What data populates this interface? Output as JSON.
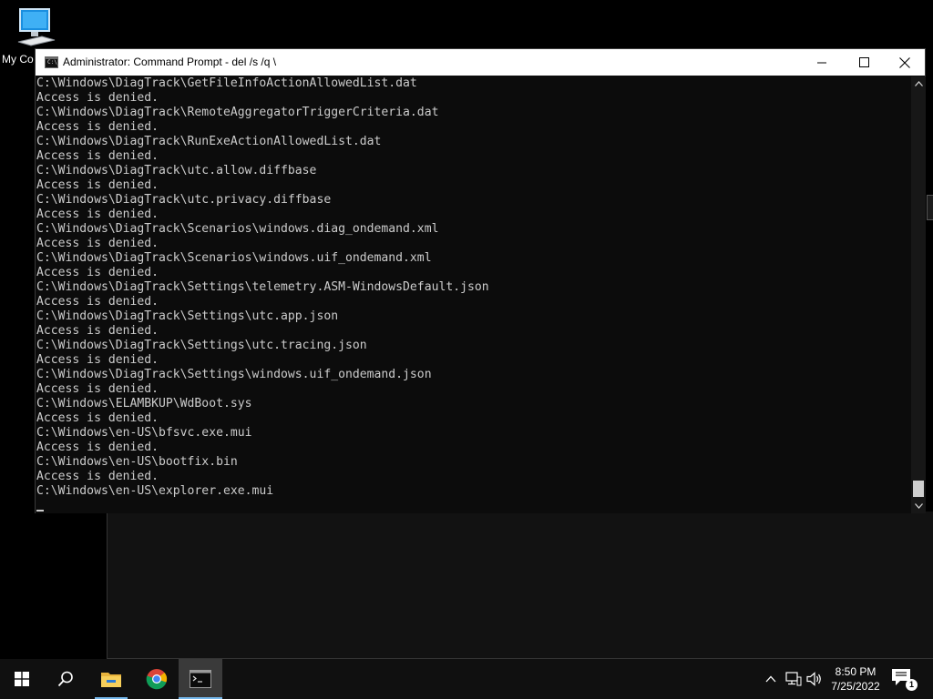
{
  "desktop": {
    "icon_label": "My Co"
  },
  "window": {
    "title": "Administrator: Command Prompt - del  /s /q \\",
    "icon_text": "C:\\_"
  },
  "console": {
    "lines": [
      "C:\\Windows\\DiagTrack\\GetFileInfoActionAllowedList.dat",
      "Access is denied.",
      "C:\\Windows\\DiagTrack\\RemoteAggregatorTriggerCriteria.dat",
      "Access is denied.",
      "C:\\Windows\\DiagTrack\\RunExeActionAllowedList.dat",
      "Access is denied.",
      "C:\\Windows\\DiagTrack\\utc.allow.diffbase",
      "Access is denied.",
      "C:\\Windows\\DiagTrack\\utc.privacy.diffbase",
      "Access is denied.",
      "C:\\Windows\\DiagTrack\\Scenarios\\windows.diag_ondemand.xml",
      "Access is denied.",
      "C:\\Windows\\DiagTrack\\Scenarios\\windows.uif_ondemand.xml",
      "Access is denied.",
      "C:\\Windows\\DiagTrack\\Settings\\telemetry.ASM-WindowsDefault.json",
      "Access is denied.",
      "C:\\Windows\\DiagTrack\\Settings\\utc.app.json",
      "Access is denied.",
      "C:\\Windows\\DiagTrack\\Settings\\utc.tracing.json",
      "Access is denied.",
      "C:\\Windows\\DiagTrack\\Settings\\windows.uif_ondemand.json",
      "Access is denied.",
      "C:\\Windows\\ELAMBKUP\\WdBoot.sys",
      "Access is denied.",
      "C:\\Windows\\en-US\\bfsvc.exe.mui",
      "Access is denied.",
      "C:\\Windows\\en-US\\bootfix.bin",
      "Access is denied.",
      "C:\\Windows\\en-US\\explorer.exe.mui"
    ]
  },
  "taskbar": {
    "clock_time": "8:50 PM",
    "clock_date": "7/25/2022",
    "notification_count": "1"
  },
  "colors": {
    "console_bg": "#0c0c0c",
    "console_fg": "#cccccc",
    "taskbar_bg": "#101010",
    "accent": "#76b9ed"
  }
}
